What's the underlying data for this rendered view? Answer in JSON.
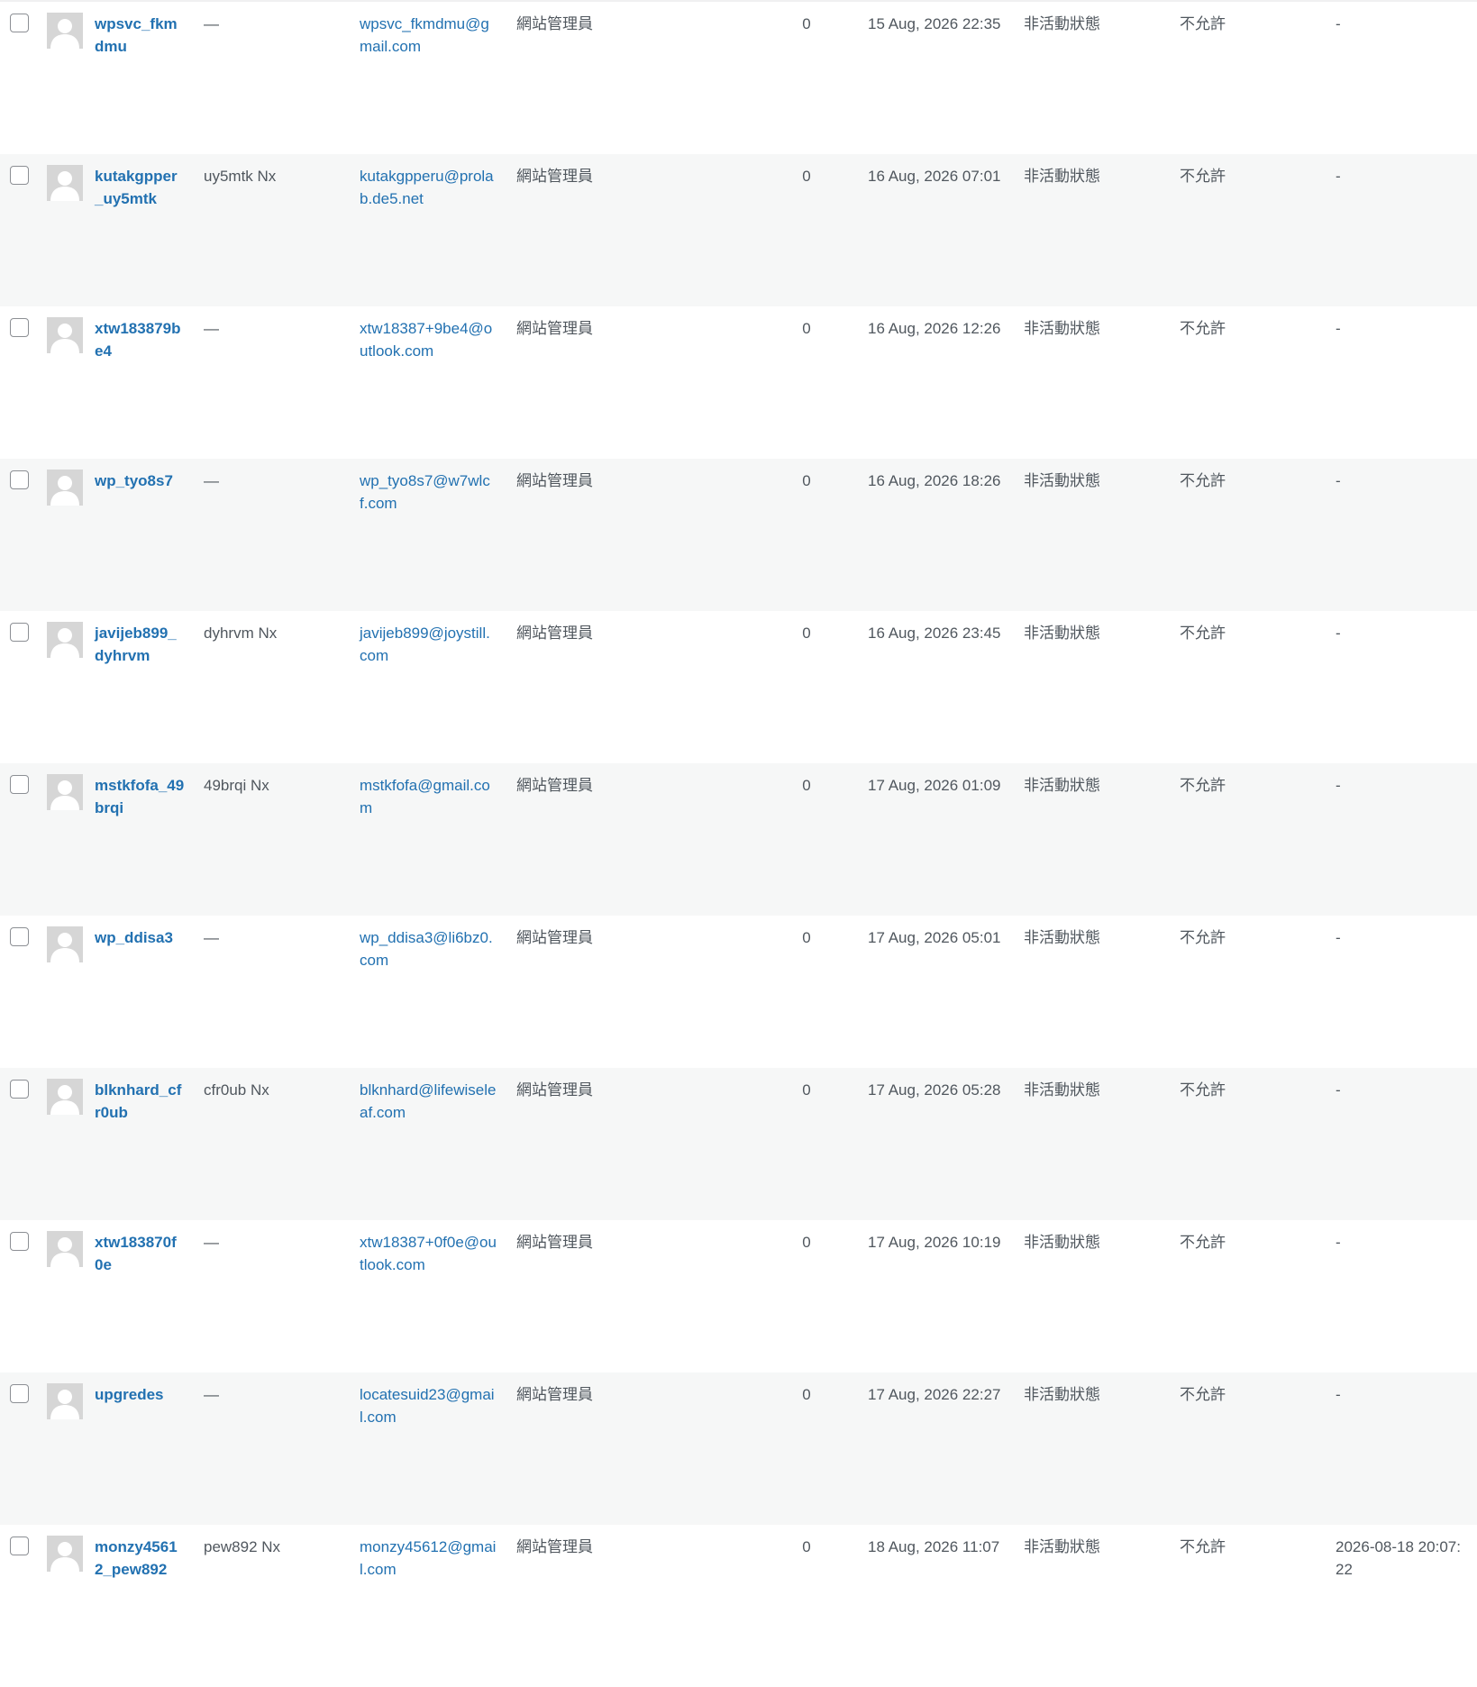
{
  "users": [
    {
      "username": "wpsvc_fkmdmu",
      "name": "—",
      "email": "wpsvc_fkmdmu@gmail.com",
      "role": "網站管理員",
      "posts": "0",
      "registered": "15 Aug, 2026 22:35",
      "status": "非活動狀態",
      "allowed": "不允許",
      "last": "-"
    },
    {
      "username": "kutakgpper_uy5mtk",
      "name": "uy5mtk Nx",
      "email": "kutakgpperu@prolab.de5.net",
      "role": "網站管理員",
      "posts": "0",
      "registered": "16 Aug, 2026 07:01",
      "status": "非活動狀態",
      "allowed": "不允許",
      "last": "-"
    },
    {
      "username": "xtw183879be4",
      "name": "—",
      "email": "xtw18387+9be4@outlook.com",
      "role": "網站管理員",
      "posts": "0",
      "registered": "16 Aug, 2026 12:26",
      "status": "非活動狀態",
      "allowed": "不允許",
      "last": "-"
    },
    {
      "username": "wp_tyo8s7",
      "name": "—",
      "email": "wp_tyo8s7@w7wlcf.com",
      "role": "網站管理員",
      "posts": "0",
      "registered": "16 Aug, 2026 18:26",
      "status": "非活動狀態",
      "allowed": "不允許",
      "last": "-"
    },
    {
      "username": "javijeb899_dyhrvm",
      "name": "dyhrvm Nx",
      "email": "javijeb899@joystill.com",
      "role": "網站管理員",
      "posts": "0",
      "registered": "16 Aug, 2026 23:45",
      "status": "非活動狀態",
      "allowed": "不允許",
      "last": "-"
    },
    {
      "username": "mstkfofa_49brqi",
      "name": "49brqi Nx",
      "email": "mstkfofa@gmail.com",
      "role": "網站管理員",
      "posts": "0",
      "registered": "17 Aug, 2026 01:09",
      "status": "非活動狀態",
      "allowed": "不允許",
      "last": "-"
    },
    {
      "username": "wp_ddisa3",
      "name": "—",
      "email": "wp_ddisa3@li6bz0.com",
      "role": "網站管理員",
      "posts": "0",
      "registered": "17 Aug, 2026 05:01",
      "status": "非活動狀態",
      "allowed": "不允許",
      "last": "-"
    },
    {
      "username": "blknhard_cfr0ub",
      "name": "cfr0ub Nx",
      "email": "blknhard@lifewiseleaf.com",
      "role": "網站管理員",
      "posts": "0",
      "registered": "17 Aug, 2026 05:28",
      "status": "非活動狀態",
      "allowed": "不允許",
      "last": "-"
    },
    {
      "username": "xtw183870f0e",
      "name": "—",
      "email": "xtw18387+0f0e@outlook.com",
      "role": "網站管理員",
      "posts": "0",
      "registered": "17 Aug, 2026 10:19",
      "status": "非活動狀態",
      "allowed": "不允許",
      "last": "-"
    },
    {
      "username": "upgredes",
      "name": "—",
      "email": "locatesuid23@gmail.com",
      "role": "網站管理員",
      "posts": "0",
      "registered": "17 Aug, 2026 22:27",
      "status": "非活動狀態",
      "allowed": "不允許",
      "last": "-"
    },
    {
      "username": "monzy45612_pew892",
      "name": "pew892 Nx",
      "email": "monzy45612@gmail.com",
      "role": "網站管理員",
      "posts": "0",
      "registered": "18 Aug, 2026 11:07",
      "status": "非活動狀態",
      "allowed": "不允許",
      "last": "2026-08-18 20:07:22"
    }
  ]
}
